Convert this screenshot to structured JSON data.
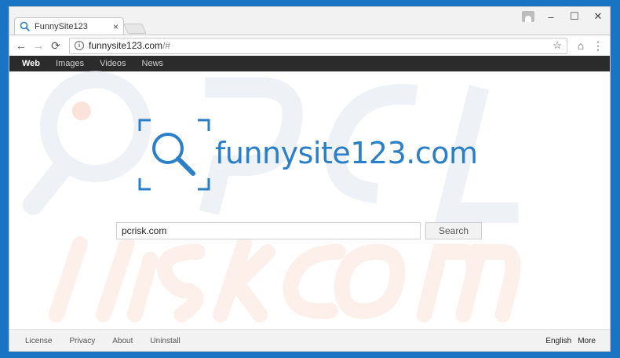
{
  "browser": {
    "tab_title": "FunnySite123",
    "tab_close": "×",
    "url_host": "funnysite123.com",
    "url_path": "/#",
    "win_minimize": "–",
    "win_maximize": "☐",
    "win_close": "✕",
    "info_icon": "i",
    "back_icon": "←",
    "forward_icon": "→",
    "reload_icon": "⟳",
    "star_icon": "☆",
    "home_icon": "⌂",
    "menu_icon": "⋮"
  },
  "topnav": {
    "items": [
      {
        "label": "Web",
        "active": true
      },
      {
        "label": "Images"
      },
      {
        "label": "Videos"
      },
      {
        "label": "News"
      }
    ]
  },
  "logo": {
    "text": "funnysite123.com",
    "color": "#2a7fc9"
  },
  "search": {
    "value": "pcrisk.com",
    "button_label": "Search"
  },
  "footer": {
    "left_links": [
      "License",
      "Privacy",
      "About",
      "Uninstall"
    ],
    "language": "English",
    "more": "More"
  },
  "colors": {
    "desktop": "#1a74c4",
    "topnav_bg": "#2b2b2b",
    "accent": "#2a7fc9"
  }
}
